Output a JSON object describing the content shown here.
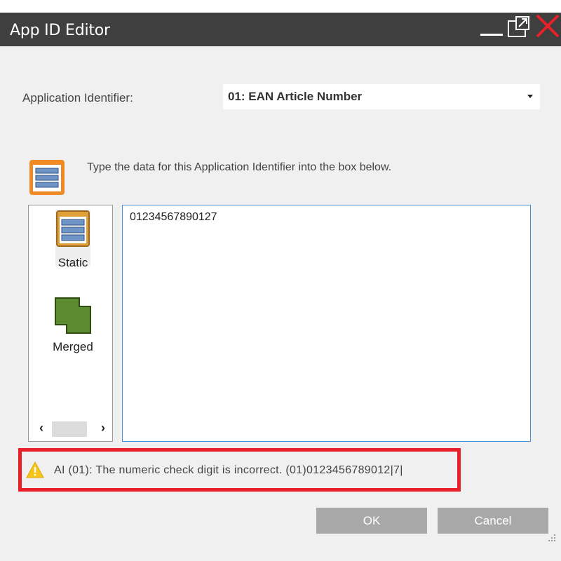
{
  "window": {
    "title": "App ID Editor",
    "titlebar_color": "#3f3f3f",
    "close_color": "#e8202a"
  },
  "form": {
    "ai_label": "Application Identifier:",
    "ai_selected": "01: EAN Article Number",
    "instruction": "Type the data for this Application Identifier into the box below."
  },
  "types": {
    "items": [
      {
        "label": "Static",
        "icon": "static-data-icon"
      },
      {
        "label": "Merged",
        "icon": "merged-data-icon"
      }
    ],
    "scroll_left_glyph": "‹",
    "scroll_right_glyph": "›"
  },
  "data_box": {
    "value": "01234567890127"
  },
  "warning": {
    "icon": "warning-icon",
    "color": "#f5c518",
    "text": "AI (01): The numeric check digit is incorrect. (01)0123456789012|7|"
  },
  "buttons": {
    "ok": "OK",
    "cancel": "Cancel"
  }
}
